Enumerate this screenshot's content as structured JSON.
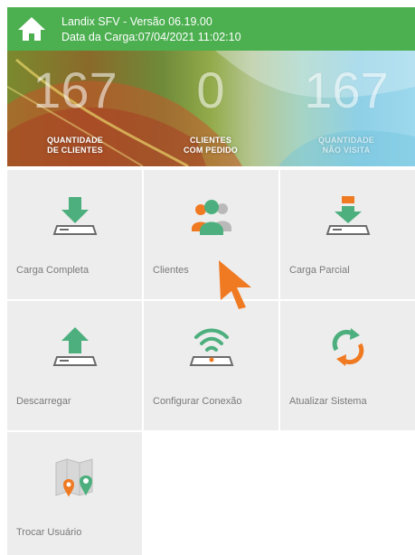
{
  "header": {
    "app_title": "Landix SFV - Versão 06.19.00",
    "load_date": "Data da Carga:07/04/2021 11:02:10",
    "home_icon": "home-icon"
  },
  "stats": [
    {
      "value": "167",
      "label_line1": "QUANTIDADE",
      "label_line2": "DE CLIENTES"
    },
    {
      "value": "0",
      "label_line1": "CLIENTES",
      "label_line2": "COM PEDIDO"
    },
    {
      "value": "167",
      "label_line1": "QUANTIDADE",
      "label_line2": "NÃO VISITA"
    }
  ],
  "tiles": [
    {
      "label": "Carga Completa",
      "icon": "download-tray-icon"
    },
    {
      "label": "Clientes",
      "icon": "people-icon"
    },
    {
      "label": "Carga Parcial",
      "icon": "partial-download-icon"
    },
    {
      "label": "Descarregar",
      "icon": "upload-tray-icon"
    },
    {
      "label": "Configurar Conexão",
      "icon": "wifi-device-icon"
    },
    {
      "label": "Atualizar Sistema",
      "icon": "refresh-icon"
    },
    {
      "label": "Trocar Usuário",
      "icon": "map-pins-icon"
    }
  ],
  "colors": {
    "header_green": "#4caf50",
    "icon_green": "#4caf7d",
    "accent_orange": "#f07a22",
    "tile_bg": "#ededed"
  }
}
